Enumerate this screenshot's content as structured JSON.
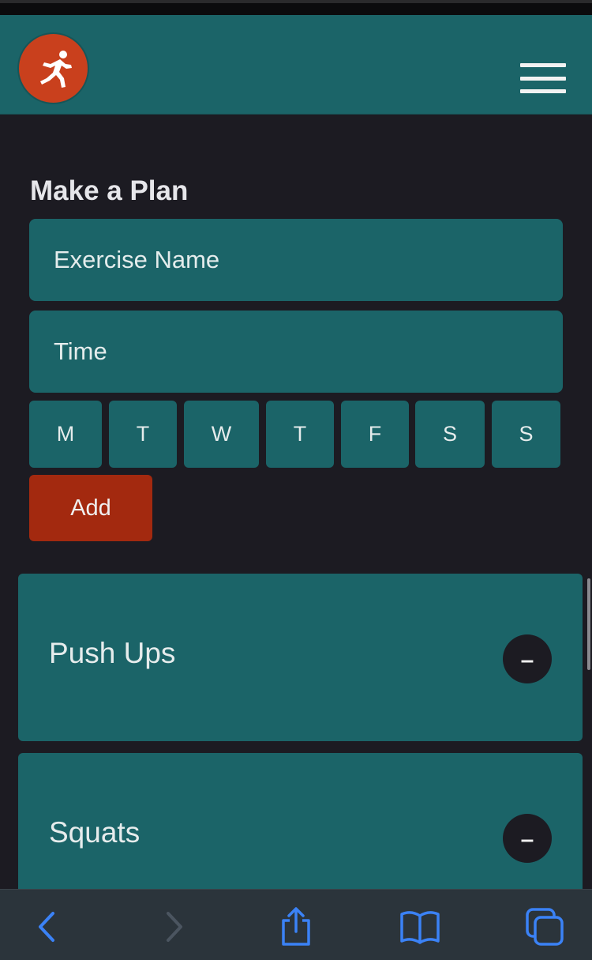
{
  "app": {
    "logo_icon": "runner-icon",
    "menu_icon": "hamburger-icon",
    "brand_color": "#1b6468",
    "accent_color": "#a3290f"
  },
  "form": {
    "title": "Make a Plan",
    "exercise_placeholder": "Exercise Name",
    "time_placeholder": "Time",
    "days": [
      "M",
      "T",
      "W",
      "T",
      "F",
      "S",
      "S"
    ],
    "add_label": "Add"
  },
  "plans": [
    {
      "name": "Push Ups",
      "remove_label": "–"
    },
    {
      "name": "Squats",
      "remove_label": "–"
    }
  ],
  "browser_toolbar": {
    "icons": [
      "back-icon",
      "forward-icon",
      "share-icon",
      "bookmarks-icon",
      "tabs-icon"
    ],
    "icon_color": "#3b82f6"
  }
}
